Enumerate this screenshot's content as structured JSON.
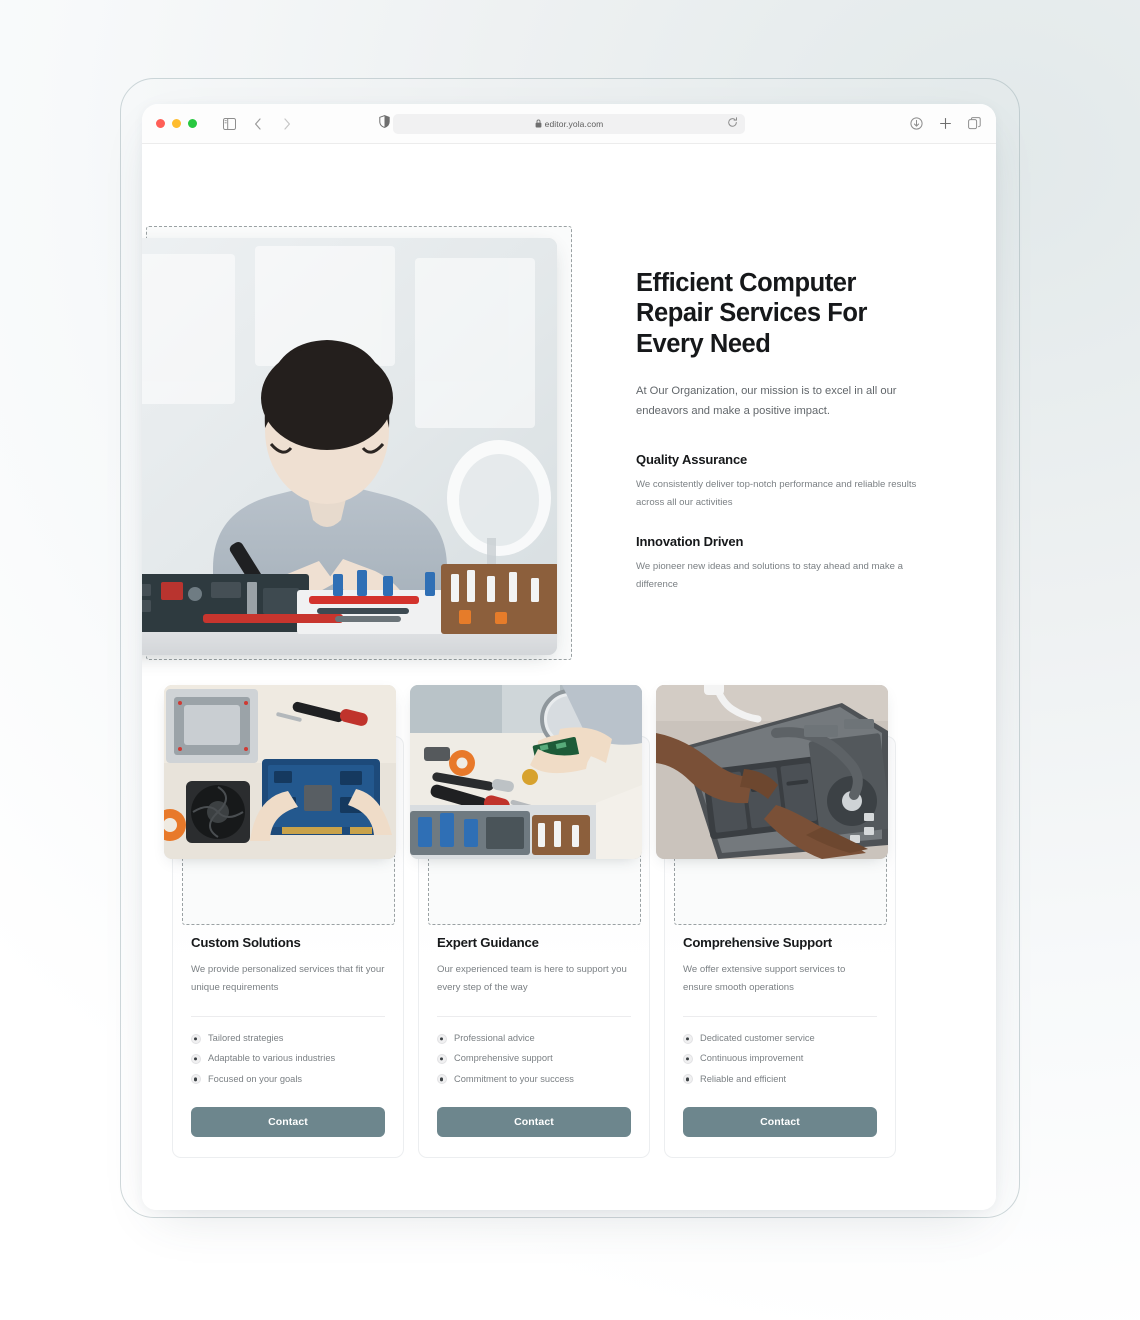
{
  "browser": {
    "url": "editor.yola.com",
    "traffic_lights": [
      "close-red",
      "minimize-yellow",
      "maximize-green"
    ],
    "icons": {
      "sidebar": "sidebar-toggle-icon",
      "back": "back-chevron-icon",
      "forward": "forward-chevron-icon",
      "shield": "privacy-shield-icon",
      "lock": "lock-icon",
      "reload": "reload-icon",
      "download": "download-icon",
      "new_tab": "plus-icon",
      "tabs": "tab-overview-icon"
    }
  },
  "hero": {
    "title": "Efficient Computer Repair Services For Every Need",
    "lead": "At Our Organization, our mission is to excel in all our endeavors and make a positive impact.",
    "features": [
      {
        "title": "Quality Assurance",
        "body": "We consistently deliver top-notch performance and reliable results across all our activities"
      },
      {
        "title": "Innovation Driven",
        "body": "We pioneer new ideas and solutions to stay ahead and make a difference"
      }
    ],
    "image_alt": "technician-soldering-circuit-board"
  },
  "cards": [
    {
      "title": "Custom Solutions",
      "desc": "We provide personalized services that fit your unique requirements",
      "list": [
        "Tailored strategies",
        "Adaptable to various industries",
        "Focused on your goals"
      ],
      "button": "Contact",
      "image_alt": "hands-holding-graphics-card"
    },
    {
      "title": "Expert Guidance",
      "desc": "Our experienced team is here to support you every step of the way",
      "list": [
        "Professional advice",
        "Comprehensive support",
        "Commitment to your success"
      ],
      "button": "Contact",
      "image_alt": "technician-inspecting-chip-with-magnifier"
    },
    {
      "title": "Comprehensive Support",
      "desc": "We offer extensive support services to ensure smooth operations",
      "list": [
        "Dedicated customer service",
        "Continuous improvement",
        "Reliable and efficient"
      ],
      "button": "Contact",
      "image_alt": "hands-repairing-open-laptop"
    }
  ],
  "colors": {
    "accent_button": "#6d868d",
    "heading": "#16181a",
    "body_text": "#7b8084",
    "selection_outline": "#9aa1a3",
    "page_background": "#ffffff"
  }
}
